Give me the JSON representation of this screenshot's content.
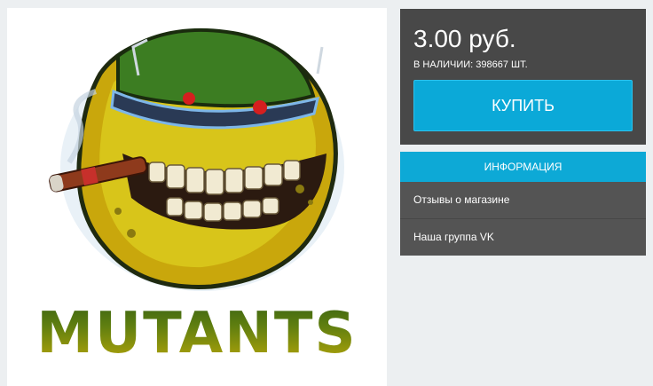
{
  "product": {
    "brand_text": "MUTANTS"
  },
  "purchase": {
    "price": "3.00 руб.",
    "stock_text": "В НАЛИЧИИ: 398667 ШТ.",
    "buy_label": "КУПИТЬ"
  },
  "info": {
    "header": "ИНФОРМАЦИЯ",
    "links": [
      {
        "label": "Отзывы о магазине"
      },
      {
        "label": "Наша группа VK"
      }
    ]
  },
  "colors": {
    "page_background": "#eceff1",
    "panel_dark": "#484848",
    "info_panel": "#545454",
    "accent": "#0ba9d8"
  }
}
